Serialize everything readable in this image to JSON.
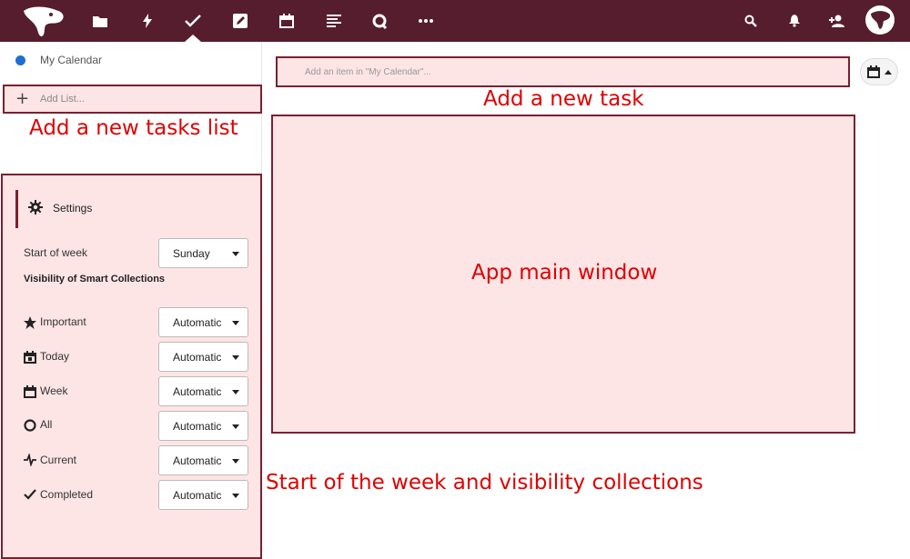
{
  "topbar": {
    "icons": [
      "app-logo",
      "files-icon",
      "activity-icon",
      "tasks-icon",
      "notes-icon",
      "calendar-icon",
      "news-icon",
      "talk-icon",
      "more-icon"
    ],
    "right_icons": [
      "search-icon",
      "notifications-icon",
      "contacts-icon",
      "avatar"
    ],
    "bg_color": "#561d2e"
  },
  "sidebar": {
    "calendars": [
      {
        "label": "My Calendar",
        "color": "#1e6ed4"
      }
    ],
    "add_list_label": "Add List...",
    "annotation_add_list": "Add a new tasks list"
  },
  "settings": {
    "title": "Settings",
    "start_of_week_label": "Start of week",
    "start_of_week_value": "Sunday",
    "visibility_heading": "Visibility of Smart Collections",
    "collections": [
      {
        "label": "Important",
        "value": "Automatic",
        "icon": "star-icon"
      },
      {
        "label": "Today",
        "value": "Automatic",
        "icon": "calendar-today-icon"
      },
      {
        "label": "Week",
        "value": "Automatic",
        "icon": "calendar-week-icon"
      },
      {
        "label": "All",
        "value": "Automatic",
        "icon": "circle-icon"
      },
      {
        "label": "Current",
        "value": "Automatic",
        "icon": "pulse-icon"
      },
      {
        "label": "Completed",
        "value": "Automatic",
        "icon": "check-icon"
      }
    ],
    "annotation": "Start of the week and visibility collections"
  },
  "main": {
    "add_task_placeholder": "Add an item in \"My Calendar\"...",
    "annotation_add_task": "Add a new task",
    "annotation_main_window": "App main window"
  },
  "colors": {
    "annotation": "#e00000",
    "highlight_fill": "#fde4e5",
    "highlight_border": "#7b2030"
  }
}
